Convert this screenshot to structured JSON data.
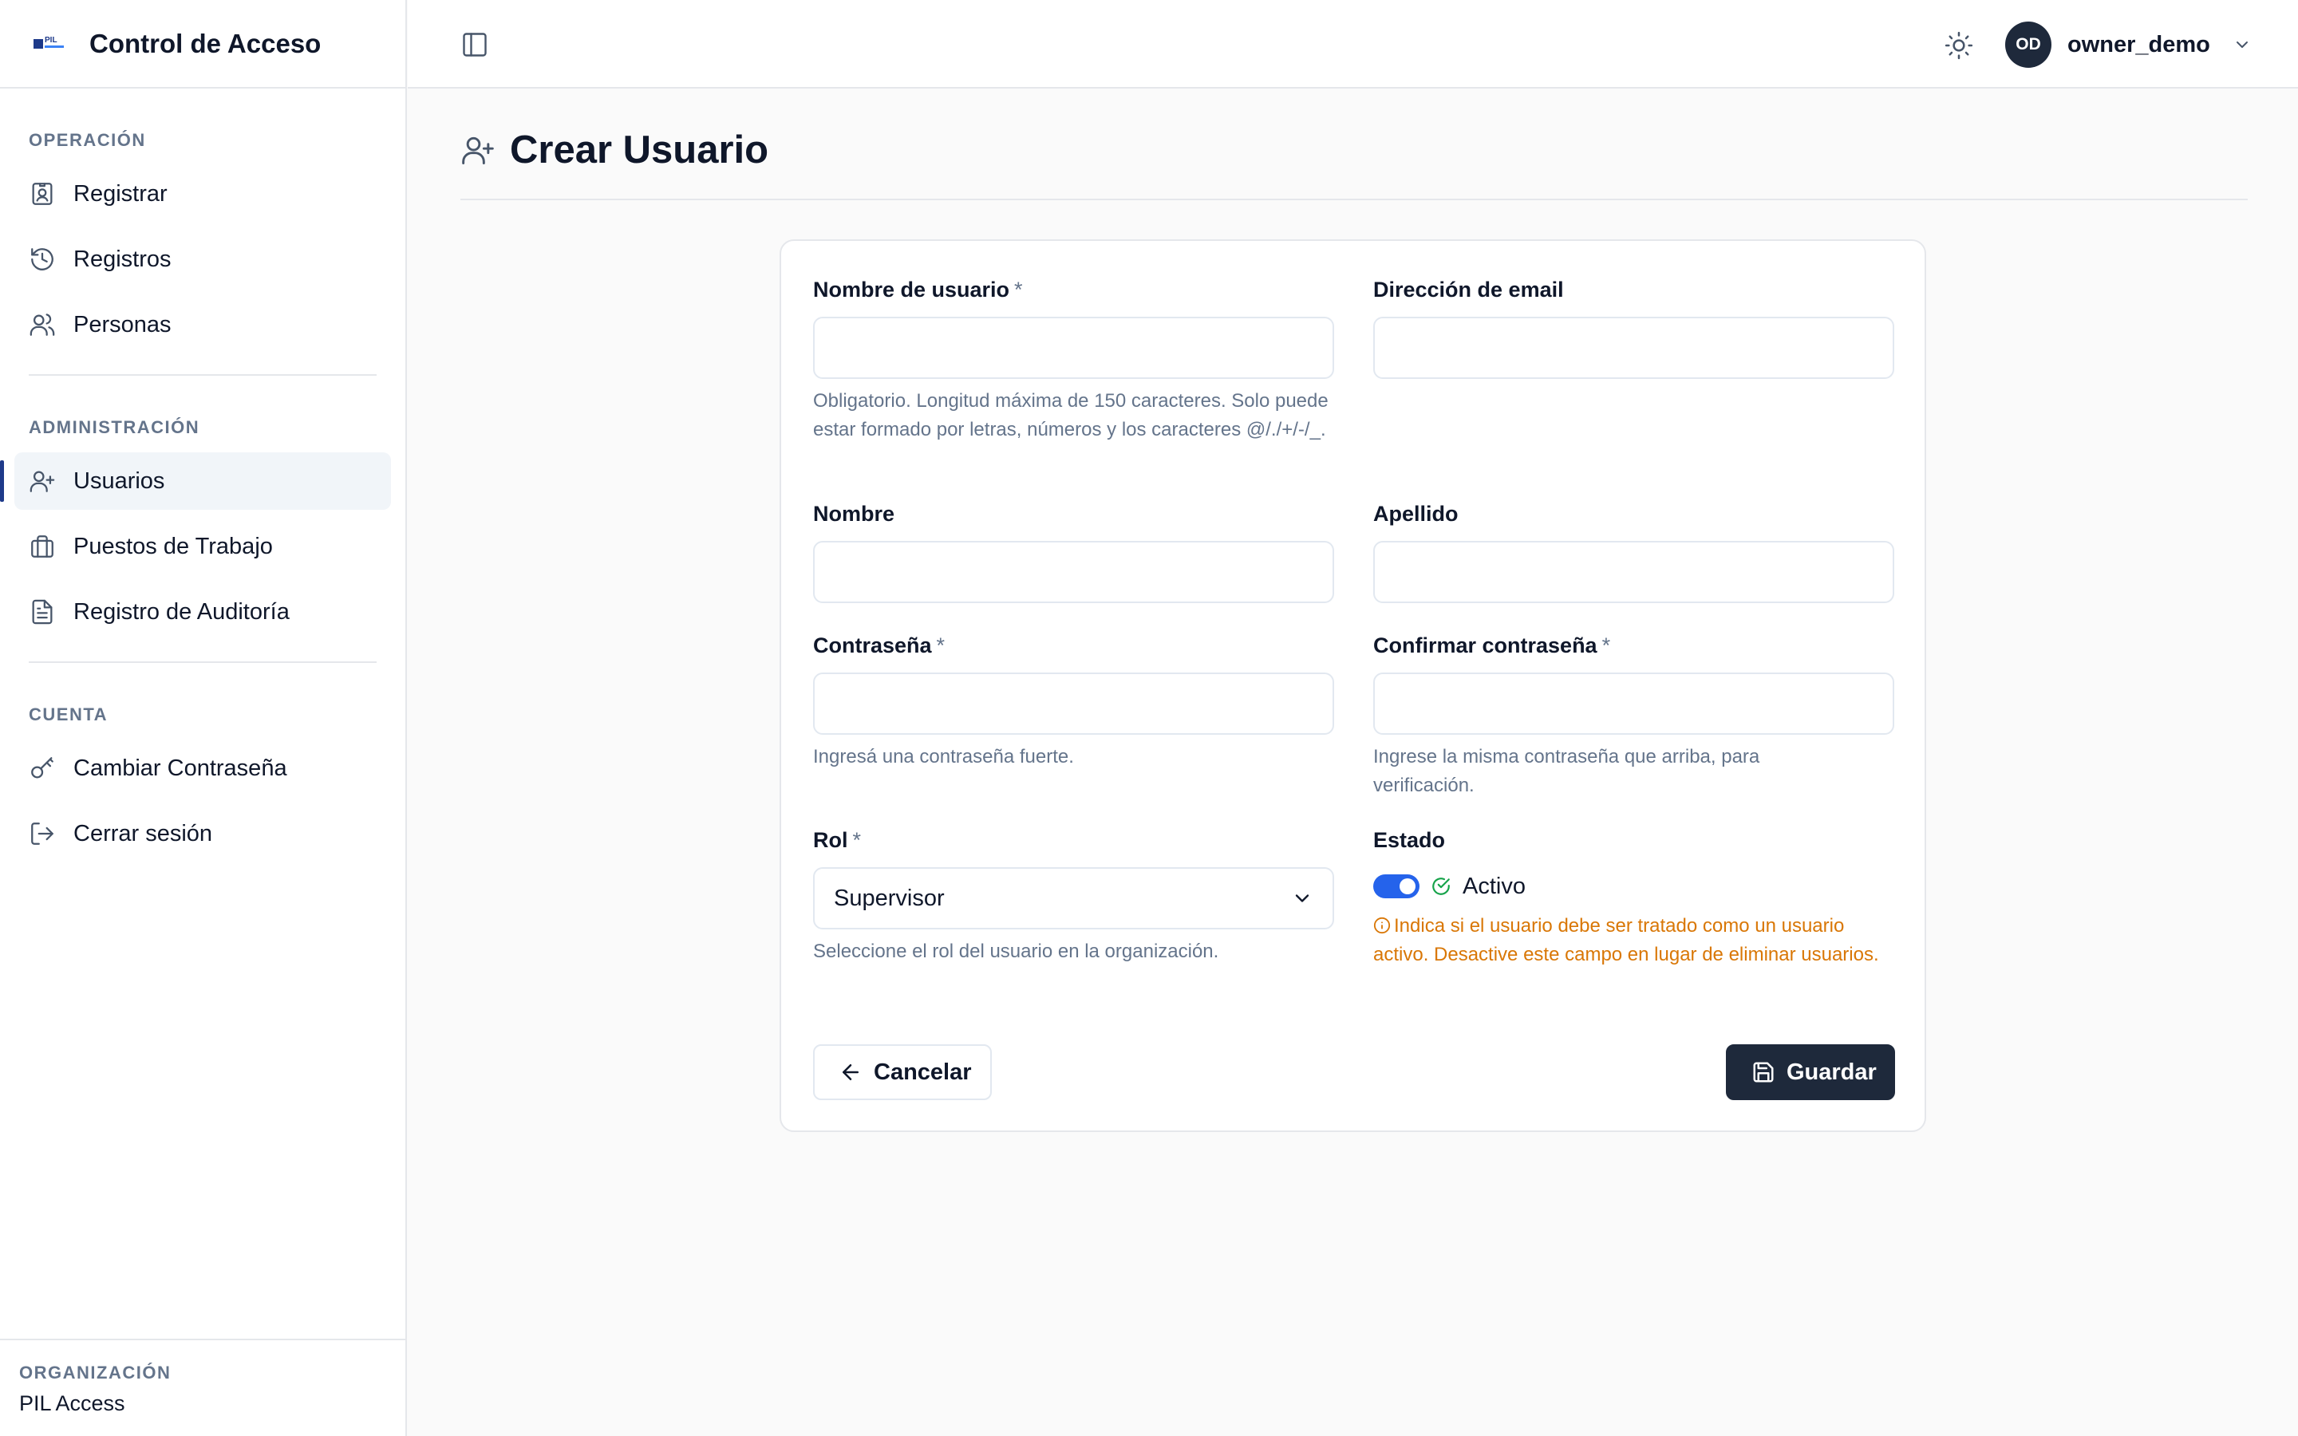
{
  "app": {
    "title": "Control de Acceso",
    "logo_text": "PIL"
  },
  "sidebar": {
    "sections": [
      {
        "label": "OPERACIÓN",
        "items": [
          {
            "label": "Registrar",
            "icon": "badge-icon"
          },
          {
            "label": "Registros",
            "icon": "history-icon"
          },
          {
            "label": "Personas",
            "icon": "users-icon"
          }
        ]
      },
      {
        "label": "ADMINISTRACIÓN",
        "items": [
          {
            "label": "Usuarios",
            "icon": "user-plus-icon",
            "active": true
          },
          {
            "label": "Puestos de Trabajo",
            "icon": "briefcase-icon"
          },
          {
            "label": "Registro de Auditoría",
            "icon": "file-text-icon"
          }
        ]
      },
      {
        "label": "CUENTA",
        "items": [
          {
            "label": "Cambiar Contraseña",
            "icon": "key-icon"
          },
          {
            "label": "Cerrar sesión",
            "icon": "logout-icon"
          }
        ]
      }
    ],
    "org": {
      "label": "ORGANIZACIÓN",
      "name": "PIL Access"
    }
  },
  "topbar": {
    "user": {
      "initials": "OD",
      "name": "owner_demo"
    }
  },
  "page": {
    "title": "Crear Usuario"
  },
  "form": {
    "username": {
      "label": "Nombre de usuario",
      "required": "*",
      "value": "",
      "help": "Obligatorio. Longitud máxima de 150 caracteres. Solo puede estar formado por letras, números y los caracteres @/./+/-/_."
    },
    "email": {
      "label": "Dirección de email",
      "value": ""
    },
    "first_name": {
      "label": "Nombre",
      "value": ""
    },
    "last_name": {
      "label": "Apellido",
      "value": ""
    },
    "password": {
      "label": "Contraseña",
      "required": "*",
      "value": "",
      "help": "Ingresá una contraseña fuerte."
    },
    "password_confirm": {
      "label": "Confirmar contraseña",
      "required": "*",
      "value": "",
      "help": "Ingrese la misma contraseña que arriba, para verificación."
    },
    "role": {
      "label": "Rol",
      "required": "*",
      "value": "Supervisor",
      "help": "Seleccione el rol del usuario en la organización."
    },
    "status": {
      "label": "Estado",
      "value": "Activo",
      "enabled": true,
      "help": "Indica si el usuario debe ser tratado como un usuario activo. Desactive este campo en lugar de eliminar usuarios."
    },
    "cancel_label": "Cancelar",
    "save_label": "Guardar"
  },
  "colors": {
    "accent": "#2563eb",
    "primary_dark": "#1e293b",
    "warning": "#d97706",
    "muted": "#64748b"
  }
}
